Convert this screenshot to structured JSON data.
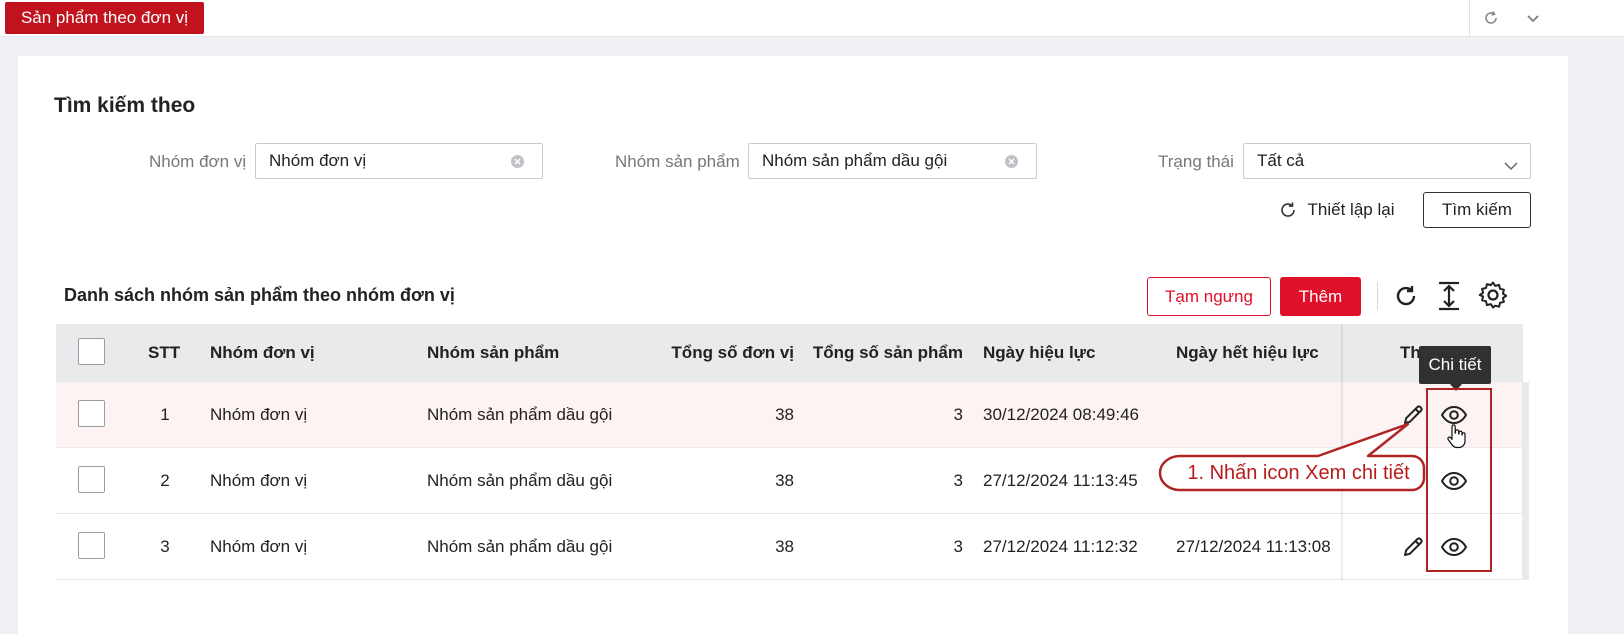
{
  "tab": {
    "title": "Sản phẩm theo đơn vị"
  },
  "topbar": {
    "refresh_icon": "refresh-icon",
    "collapse_icon": "chevron-down-icon"
  },
  "search": {
    "title": "Tìm kiếm theo",
    "group_unit": {
      "label": "Nhóm đơn vị",
      "value": "Nhóm đơn vị"
    },
    "group_product": {
      "label": "Nhóm sản phẩm",
      "value": "Nhóm sản phẩm dầu gội"
    },
    "status": {
      "label": "Trạng thái",
      "value": "Tất cả"
    },
    "reset_label": "Thiết lập lại",
    "search_label": "Tìm kiếm"
  },
  "list": {
    "title": "Danh sách nhóm sản phẩm theo nhóm đơn vị",
    "suspend_label": "Tạm ngưng",
    "add_label": "Thêm",
    "accent": "#e0102a"
  },
  "table": {
    "headers": {
      "stt": "STT",
      "unit_group": "Nhóm đơn vị",
      "product_group": "Nhóm sản phẩm",
      "total_units": "Tổng số đơn vị",
      "total_products": "Tổng số sản phẩm",
      "effective": "Ngày hiệu lực",
      "expiry": "Ngày hết hiệu lực",
      "actions": "Thao tác"
    },
    "rows": [
      {
        "stt": "1",
        "unit_group": "Nhóm đơn vị",
        "product_group": "Nhóm sản phẩm dầu gội",
        "total_units": "38",
        "total_products": "3",
        "effective": "30/12/2024 08:49:46",
        "expiry": ""
      },
      {
        "stt": "2",
        "unit_group": "Nhóm đơn vị",
        "product_group": "Nhóm sản phẩm dầu gội",
        "total_units": "38",
        "total_products": "3",
        "effective": "27/12/2024 11:13:45",
        "expiry": ""
      },
      {
        "stt": "3",
        "unit_group": "Nhóm đơn vị",
        "product_group": "Nhóm sản phẩm dầu gội",
        "total_units": "38",
        "total_products": "3",
        "effective": "27/12/2024 11:12:32",
        "expiry": "27/12/2024 11:13:08"
      }
    ]
  },
  "tooltip": {
    "text": "Chi tiết"
  },
  "annotation": {
    "text": "1. Nhấn icon Xem chi tiết",
    "color": "#b71c1c"
  }
}
